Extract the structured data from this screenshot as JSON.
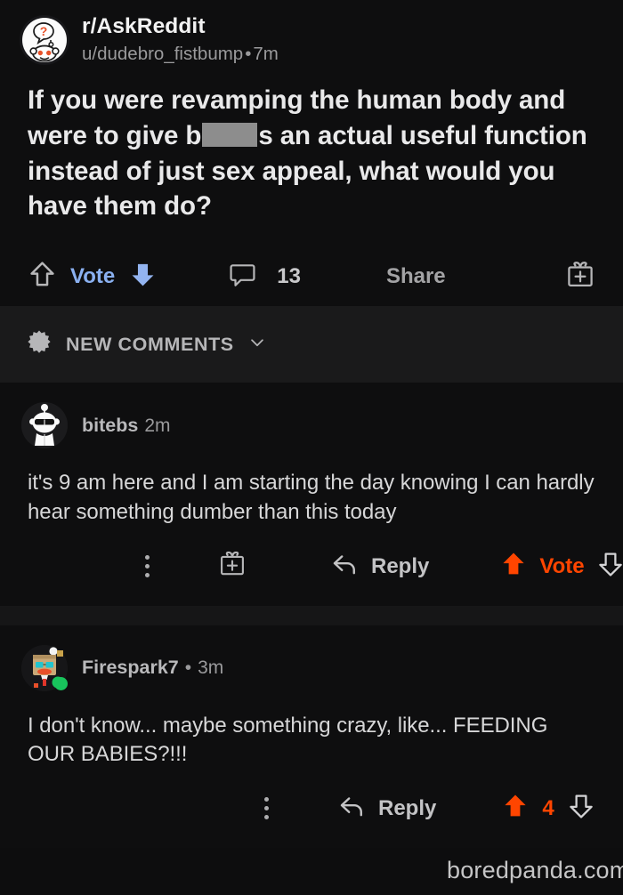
{
  "post": {
    "avatar_icon": "reddit-snoo-question-avatar",
    "subreddit": "r/AskReddit",
    "author": "u/dudebro_fistbump",
    "separator": "•",
    "timestamp": "7m",
    "title_part1": "If you were revamping the human body and were to give b",
    "title_redacted": "[redacted]",
    "title_part2": "s an actual useful function instead of just sex appeal, what would you have them do?",
    "actions": {
      "upvote_icon": "upvote-arrow-icon",
      "vote_label": "Vote",
      "downvote_icon": "downvote-arrow-filled-icon",
      "comment_icon": "comment-bubble-icon",
      "comment_count": "13",
      "share_label": "Share",
      "gift_icon": "gift-plus-icon"
    },
    "vote_color": "#8ab0f0"
  },
  "new_comments_bar": {
    "icon": "sparkle-burst-icon",
    "label": "NEW COMMENTS",
    "chevron_icon": "chevron-down-icon"
  },
  "comments": [
    {
      "avatar_icon": "snoo-sunglasses-avatar",
      "author": "bitebs",
      "timestamp": "2m",
      "body": "it's 9 am here and I am starting the day knowing I can hardly hear something dumber than this today",
      "actions": {
        "overflow_icon": "overflow-dots-icon",
        "gift_icon": "gift-plus-icon",
        "reply_icon": "reply-arrow-icon",
        "reply_label": "Reply",
        "upvote_icon": "upvote-arrow-filled-icon",
        "vote_label": "Vote",
        "downvote_icon": "downvote-arrow-icon"
      },
      "vote_color": "#ff4500"
    },
    {
      "avatar_icon": "box-head-avatar",
      "author": "Firespark7",
      "separator": "•",
      "timestamp": "3m",
      "online": true,
      "body": "I don't know... maybe something crazy, like... FEEDING OUR BABIES?!!!",
      "actions": {
        "overflow_icon": "overflow-dots-icon",
        "reply_icon": "reply-arrow-icon",
        "reply_label": "Reply",
        "upvote_icon": "upvote-arrow-filled-icon",
        "vote_count": "4",
        "downvote_icon": "downvote-arrow-icon"
      },
      "vote_color": "#ff4500"
    }
  ],
  "watermark": {
    "text": "boredpanda.com"
  }
}
